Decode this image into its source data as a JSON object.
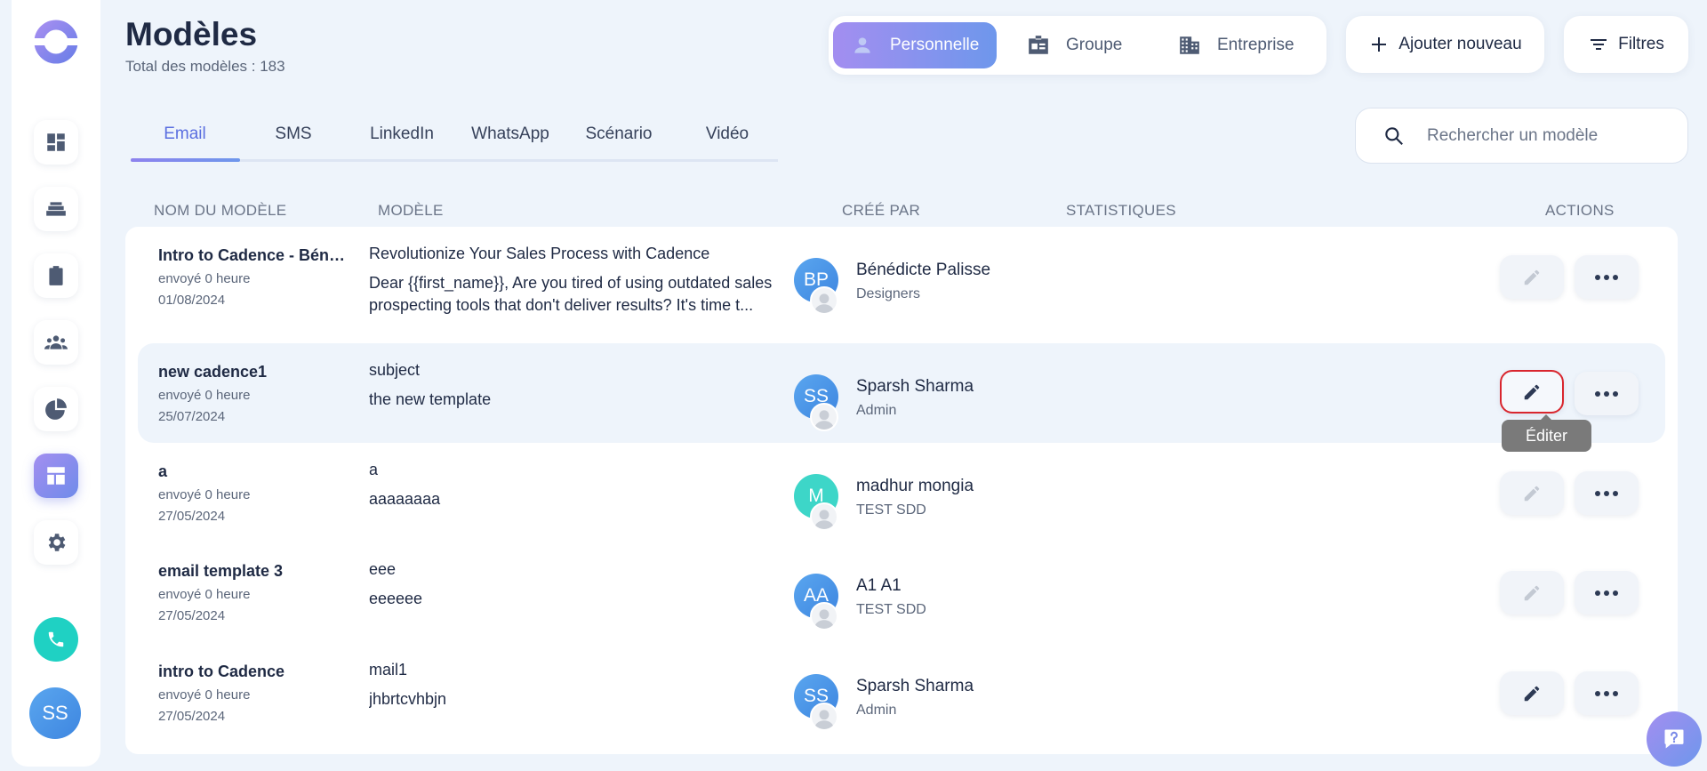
{
  "header": {
    "title": "Modèles",
    "subtitle": "Total des modèles : 183"
  },
  "scope": {
    "items": [
      {
        "label": "Personnelle",
        "icon": "person-icon",
        "active": true
      },
      {
        "label": "Groupe",
        "icon": "id-card-icon",
        "active": false
      },
      {
        "label": "Entreprise",
        "icon": "building-icon",
        "active": false
      }
    ]
  },
  "actions": {
    "add_label": "Ajouter nouveau",
    "filter_label": "Filtres"
  },
  "tabs": [
    {
      "label": "Email",
      "active": true
    },
    {
      "label": "SMS",
      "active": false
    },
    {
      "label": "LinkedIn",
      "active": false
    },
    {
      "label": "WhatsApp",
      "active": false
    },
    {
      "label": "Scénario",
      "active": false
    },
    {
      "label": "Vidéo",
      "active": false
    }
  ],
  "search": {
    "placeholder": "Rechercher un modèle",
    "value": ""
  },
  "table": {
    "columns": [
      "NOM DU MODÈLE",
      "MODÈLE",
      "CRÉÉ PAR",
      "STATISTIQUES",
      "ACTIONS"
    ],
    "rows": [
      {
        "name": "Intro to Cadence - Bénédicte",
        "sent": "envoyé 0 heure",
        "date": "01/08/2024",
        "subject": "Revolutionize Your Sales Process with Cadence",
        "body": "Dear {{first_name}},   Are you tired of using outdated sales prospecting tools that don't deliver results? It's time t...",
        "initials": "BP",
        "creator": "Bénédicte Palisse",
        "role": "Designers",
        "avatar_color": "#4a95e8",
        "edit_enabled": false
      },
      {
        "name": "new cadence1",
        "sent": "envoyé 0 heure",
        "date": "25/07/2024",
        "subject": "subject",
        "body": "the new template",
        "initials": "SS",
        "creator": "Sparsh Sharma",
        "role": "Admin",
        "avatar_color": "#4a95e8",
        "edit_enabled": true
      },
      {
        "name": "a",
        "sent": "envoyé 0 heure",
        "date": "27/05/2024",
        "subject": "a",
        "body": "aaaaaaaa",
        "initials": "M",
        "creator": "madhur mongia",
        "role": "TEST SDD",
        "avatar_color": "#3dd6c8",
        "edit_enabled": false
      },
      {
        "name": "email template 3",
        "sent": "envoyé 0 heure",
        "date": "27/05/2024",
        "subject": "eee",
        "body": "eeeeee",
        "initials": "AA",
        "creator": "A1 A1",
        "role": "TEST SDD",
        "avatar_color": "#4a95e8",
        "edit_enabled": false
      },
      {
        "name": "intro to Cadence",
        "sent": "envoyé 0 heure",
        "date": "27/05/2024",
        "subject": "mail1",
        "body": "jhbrtcvhbjn",
        "initials": "SS",
        "creator": "Sparsh Sharma",
        "role": "Admin",
        "avatar_color": "#4a95e8",
        "edit_enabled": true
      }
    ]
  },
  "tooltip": "Éditer",
  "user": {
    "initials": "SS"
  },
  "colors": {
    "accent_start": "#a38ef0",
    "accent_end": "#6e97ec",
    "focus_outline": "#d9262e",
    "phone": "#1fd1c3"
  }
}
